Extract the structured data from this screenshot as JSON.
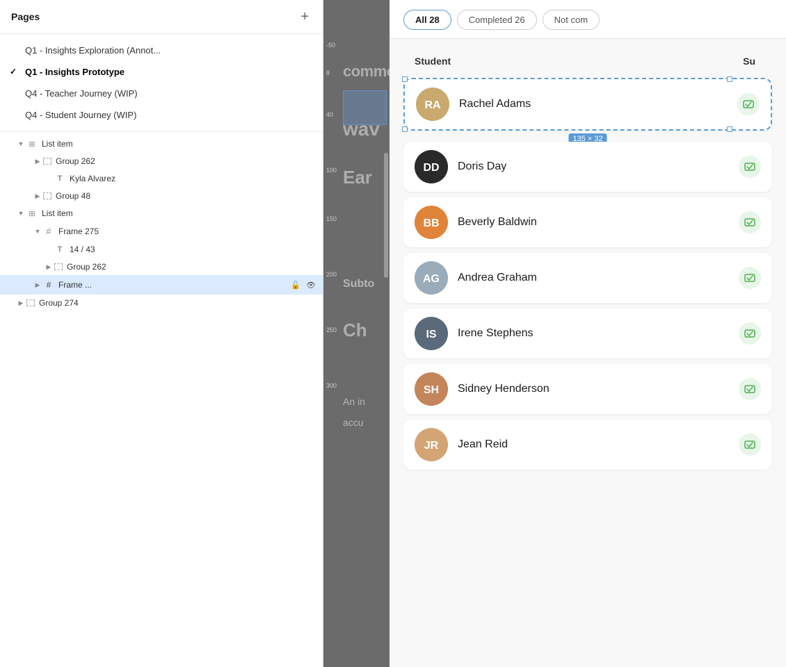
{
  "pages": {
    "header": "Pages",
    "add_label": "+",
    "items": [
      {
        "id": "q1-annot",
        "label": "Q1 - Insights Exploration (Annot...",
        "active": false
      },
      {
        "id": "q1-proto",
        "label": "Q1 - Insights Prototype",
        "active": true
      },
      {
        "id": "q4-teacher",
        "label": "Q4 - Teacher Journey (WIP)",
        "active": false
      },
      {
        "id": "q4-student",
        "label": "Q4 - Student Journey (WIP)",
        "active": false
      }
    ]
  },
  "layers": [
    {
      "id": "list-item-1",
      "label": "List item",
      "indent": 1,
      "chevron": "down",
      "icon": "columns"
    },
    {
      "id": "group-262-a",
      "label": "Group 262",
      "indent": 2,
      "chevron": "right",
      "icon": "dashed-rect"
    },
    {
      "id": "kyla",
      "label": "Kyla Alvarez",
      "indent": 3,
      "chevron": "none",
      "icon": "text"
    },
    {
      "id": "group-48",
      "label": "Group 48",
      "indent": 2,
      "chevron": "right",
      "icon": "dashed-rect"
    },
    {
      "id": "list-item-2",
      "label": "List item",
      "indent": 1,
      "chevron": "down",
      "icon": "columns"
    },
    {
      "id": "frame-275",
      "label": "Frame 275",
      "indent": 2,
      "chevron": "down",
      "icon": "hash"
    },
    {
      "id": "14-43",
      "label": "14 / 43",
      "indent": 3,
      "chevron": "none",
      "icon": "text"
    },
    {
      "id": "group-262-b",
      "label": "Group 262",
      "indent": 3,
      "chevron": "right",
      "icon": "dashed-rect"
    },
    {
      "id": "frame-dots",
      "label": "Frame ...",
      "indent": 2,
      "chevron": "right",
      "icon": "hash",
      "selected": true,
      "actions": [
        "lock",
        "eye"
      ]
    },
    {
      "id": "group-274",
      "label": "Group 274",
      "indent": 1,
      "chevron": "right",
      "icon": "dashed-rect"
    }
  ],
  "tabs": [
    {
      "id": "all",
      "label": "All 28",
      "active": true
    },
    {
      "id": "completed",
      "label": "Completed 26",
      "active": false
    },
    {
      "id": "not-completed",
      "label": "Not com",
      "active": false
    }
  ],
  "table": {
    "col_student": "Student",
    "col_status": "Su",
    "students": [
      {
        "id": "rachel",
        "name": "Rachel Adams",
        "color": "#c9a96e",
        "selected": true,
        "initials": "RA"
      },
      {
        "id": "doris",
        "name": "Doris Day",
        "color": "#1a1a1a",
        "selected": false,
        "initials": "DD"
      },
      {
        "id": "beverly",
        "name": "Beverly Baldwin",
        "color": "#e0843a",
        "selected": false,
        "initials": "BB"
      },
      {
        "id": "andrea",
        "name": "Andrea Graham",
        "color": "#aaa",
        "selected": false,
        "initials": "AG"
      },
      {
        "id": "irene",
        "name": "Irene Stephens",
        "color": "#5a6a7a",
        "selected": false,
        "initials": "IS"
      },
      {
        "id": "sidney",
        "name": "Sidney Henderson",
        "color": "#c4855a",
        "selected": false,
        "initials": "SH"
      },
      {
        "id": "jean",
        "name": "Jean Reid",
        "color": "#d4a574",
        "selected": false,
        "initials": "JR"
      }
    ]
  },
  "selection_label": "135 × 32",
  "canvas": {
    "texts": [
      "commo",
      "wav",
      "Ear",
      "Subto",
      "Ch",
      "An in",
      "accu"
    ]
  },
  "ruler": {
    "ticks": [
      "-50",
      "8",
      "40",
      "100",
      "150",
      "200",
      "250",
      "300"
    ]
  }
}
